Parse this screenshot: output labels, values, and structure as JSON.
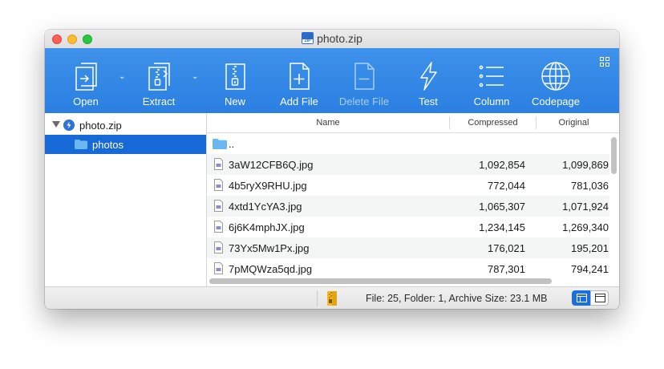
{
  "window": {
    "title": "photo.zip",
    "title_icon_text": "ZIP"
  },
  "toolbar": {
    "buttons": [
      {
        "label": "Open",
        "icon": "open-icon",
        "has_menu": true,
        "enabled": true
      },
      {
        "label": "Extract",
        "icon": "extract-icon",
        "has_menu": true,
        "enabled": true
      },
      {
        "label": "New",
        "icon": "new-archive-icon",
        "has_menu": false,
        "enabled": true
      },
      {
        "label": "Add File",
        "icon": "add-file-icon",
        "has_menu": false,
        "enabled": true
      },
      {
        "label": "Delete File",
        "icon": "delete-file-icon",
        "has_menu": false,
        "enabled": false
      },
      {
        "label": "Test",
        "icon": "test-icon",
        "has_menu": false,
        "enabled": true
      },
      {
        "label": "Column",
        "icon": "column-icon",
        "has_menu": false,
        "enabled": true
      },
      {
        "label": "Codepage",
        "icon": "globe-icon",
        "has_menu": false,
        "enabled": true
      }
    ],
    "menu_glyph": "⌄",
    "background_colors": [
      "#3e92ea",
      "#2a7fe2"
    ]
  },
  "sidebar": {
    "items": [
      {
        "label": "photo.zip",
        "icon": "zip-archive-icon",
        "expanded": true,
        "selected": false
      },
      {
        "label": "photos",
        "icon": "folder-icon",
        "selected": true
      }
    ],
    "selection_color": "#1769d8"
  },
  "table": {
    "columns": [
      "Name",
      "Compressed",
      "Original"
    ],
    "parent_row": {
      "name": ".."
    },
    "rows": [
      {
        "name": "3aW12CFB6Q.jpg",
        "compressed": "1,092,854",
        "original": "1,099,869"
      },
      {
        "name": "4b5ryX9RHU.jpg",
        "compressed": "772,044",
        "original": "781,036"
      },
      {
        "name": "4xtd1YcYA3.jpg",
        "compressed": "1,065,307",
        "original": "1,071,924"
      },
      {
        "name": "6j6K4mphJX.jpg",
        "compressed": "1,234,145",
        "original": "1,269,340"
      },
      {
        "name": "73Yx5Mw1Px.jpg",
        "compressed": "176,021",
        "original": "195,201"
      },
      {
        "name": "7pMQWza5qd.jpg",
        "compressed": "787,301",
        "original": "794,241"
      }
    ]
  },
  "status": {
    "text": "File: 25, Folder: 1, Archive Size: 23.1 MB",
    "active_view": "list"
  }
}
